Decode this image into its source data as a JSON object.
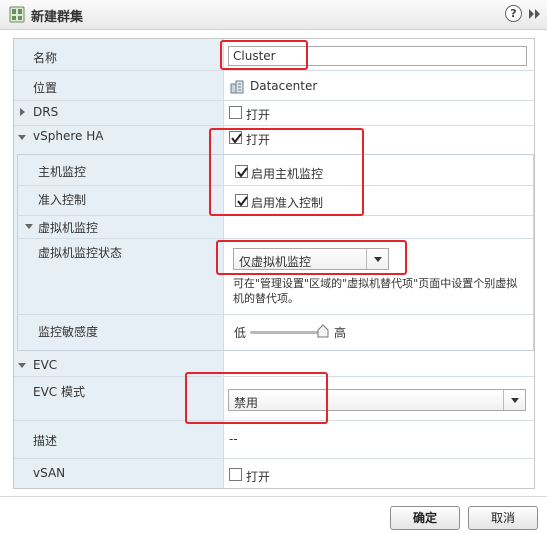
{
  "dialog": {
    "title": "新建群集",
    "help_glyph": "?",
    "icon": "cluster-icon",
    "expand_icon": "double-chevron-right-icon"
  },
  "fields": {
    "name": {
      "label": "名称",
      "value": "Cluster"
    },
    "location": {
      "label": "位置",
      "value": "Datacenter",
      "icon": "datacenter-icon"
    },
    "drs": {
      "label": "DRS",
      "checkbox_label": "打开",
      "checked": false
    },
    "ha": {
      "label": "vSphere HA",
      "checkbox_label": "打开",
      "checked": true,
      "host_monitoring": {
        "label": "主机监控",
        "checkbox_label": "启用主机监控",
        "checked": true
      },
      "admission_control": {
        "label": "准入控制",
        "checkbox_label": "启用准入控制",
        "checked": true
      },
      "vm_monitoring": {
        "label": "虚拟机监控",
        "status": {
          "label": "虚拟机监控状态",
          "value": "仅虚拟机监控",
          "note": "可在\"管理设置\"区域的\"虚拟机替代项\"页面中设置个别虚拟机的替代项。"
        },
        "sensitivity": {
          "label": "监控敏感度",
          "low": "低",
          "high": "高",
          "level": 1.0
        }
      }
    },
    "evc": {
      "label": "EVC",
      "mode": {
        "label": "EVC 模式",
        "value": "禁用"
      },
      "description": {
        "label": "描述",
        "value": "--"
      }
    },
    "vsan": {
      "label": "vSAN",
      "checkbox_label": "打开",
      "checked": false
    }
  },
  "footer": {
    "ok_label": "确定",
    "cancel_label": "取消"
  },
  "colors": {
    "annotation_red": "#e3242b",
    "label_column_bg": "#e6eef6"
  }
}
